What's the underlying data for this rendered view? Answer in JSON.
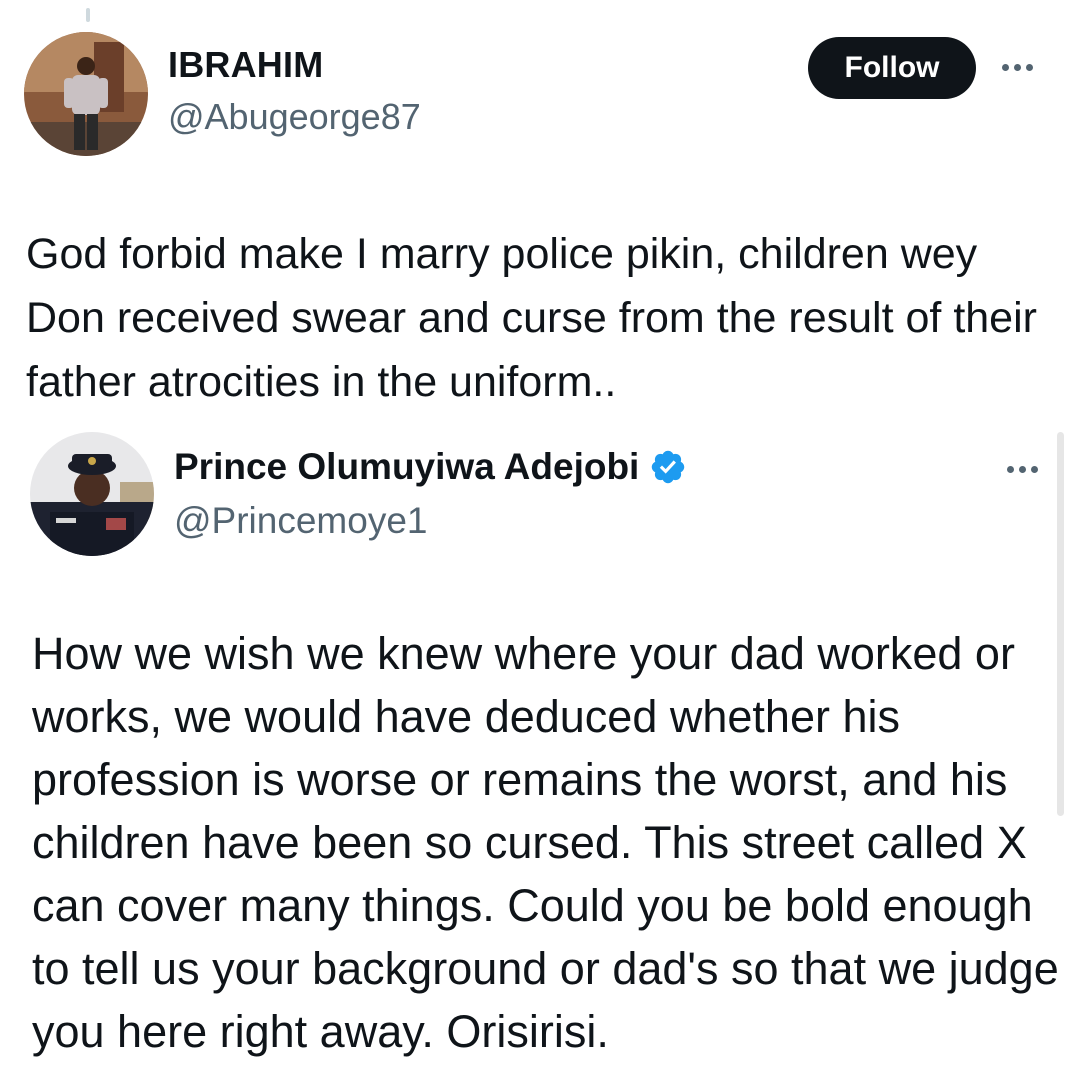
{
  "tweet": {
    "author_name": "IBRAHIM",
    "author_handle": "@Abugeorge87",
    "follow_label": "Follow",
    "text": "God forbid make I marry police pikin,  children wey Don received swear and curse from the result of their father atrocities in the uniform..",
    "more_icon": "ellipsis-icon"
  },
  "quoted_tweet": {
    "author_name": "Prince Olumuyiwa Adejobi",
    "author_handle": "@Princemoye1",
    "verified_icon": "verified-badge-icon",
    "verified_color": "#1d9bf0",
    "text": "How we wish we knew where your dad worked or works, we would have deduced whether his profession is worse or remains the worst, and his children have been so cursed. This street called X can cover many things. Could you be bold enough to tell us your background or dad's so that we judge you here right away. Orisirisi.",
    "more_icon": "ellipsis-icon"
  },
  "colors": {
    "text_primary": "#0f1419",
    "text_secondary": "#536471",
    "follow_button_bg": "#0f1419",
    "follow_button_text": "#ffffff"
  }
}
